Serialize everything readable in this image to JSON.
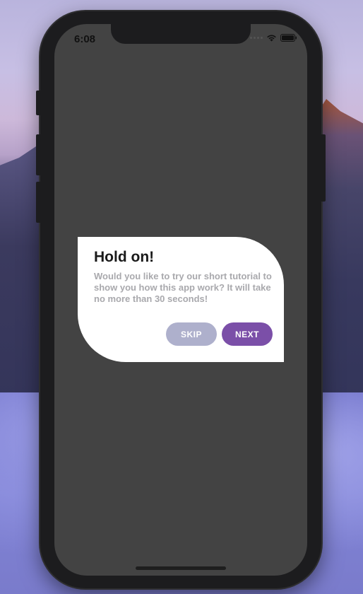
{
  "status_bar": {
    "time": "6:08",
    "icons": [
      "signal-dots-icon",
      "wifi-icon",
      "battery-icon"
    ]
  },
  "dialog": {
    "title": "Hold on!",
    "body": "Would you like to try our short tutorial to show you how this app work? It will take no more than 30 seconds!",
    "skip_label": "SKIP",
    "next_label": "NEXT"
  },
  "colors": {
    "screen_background": "#434343",
    "dialog_background": "#ffffff",
    "skip_button": "#aeb0cc",
    "next_button": "#7b4fa8",
    "title_text": "#1a1a1a",
    "body_text": "#a9a9ad"
  }
}
